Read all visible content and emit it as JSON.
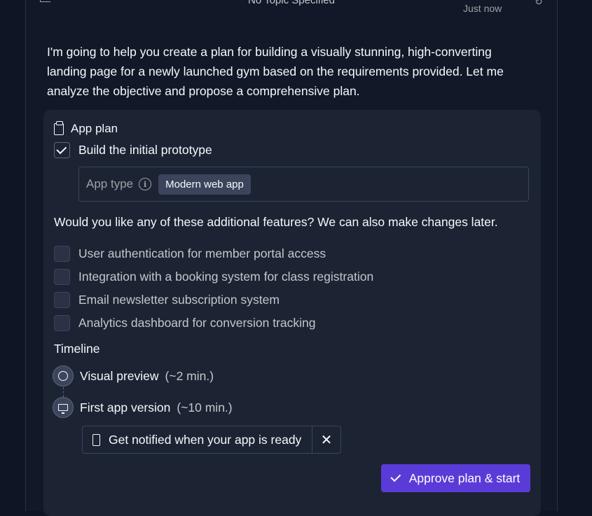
{
  "header": {
    "topic": "No Topic Specified",
    "timestamp": "Just now"
  },
  "message": {
    "intro": "I'm going to help you create a plan for building a visually stunning, high-converting landing page for a newly launched gym based on the requirements provided. Let me analyze the objective and propose a comprehensive plan."
  },
  "plan": {
    "title": "App plan",
    "prototype_label": "Build the initial prototype",
    "prototype_checked": true,
    "app_type_label": "App type",
    "app_type_value": "Modern web app",
    "question": "Would you like any of these additional features? We can also make changes later.",
    "features": [
      {
        "label": "User authentication for member portal access",
        "checked": false
      },
      {
        "label": "Integration with a booking system for class registration",
        "checked": false
      },
      {
        "label": "Email newsletter subscription system",
        "checked": false
      },
      {
        "label": "Analytics dashboard for conversion tracking",
        "checked": false
      }
    ],
    "timeline_title": "Timeline",
    "timeline": [
      {
        "label": "Visual preview",
        "duration": "(~2 min.)",
        "icon": "palette-icon"
      },
      {
        "label": "First app version",
        "duration": "(~10 min.)",
        "icon": "monitor-icon"
      }
    ],
    "notify_label": "Get notified when your app is ready",
    "approve_label": "Approve plan & start"
  },
  "colors": {
    "background": "#0e1525",
    "card": "#1c2333",
    "accent": "#5b3bd8"
  }
}
